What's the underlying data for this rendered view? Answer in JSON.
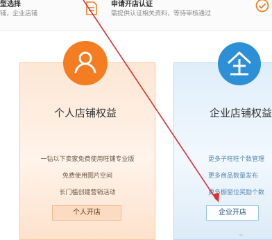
{
  "steps": {
    "step1": {
      "title": "型选择",
      "desc": "铺，企业店铺"
    },
    "step2": {
      "title": "申请开店认证",
      "desc": "需提供认证相关资料，等待审核通过"
    }
  },
  "personal": {
    "title": "个人店铺权益",
    "benefits": [
      "一钻以下卖家免费使用旺铺专业版",
      "免费使用图片空间",
      "长门槛创建营销活动"
    ],
    "button": "个人开店",
    "color": "#f47d22"
  },
  "enterprise": {
    "title": "企业店铺权益",
    "benefits": [
      "更多子旺旺个数管理",
      "更多商品数量发布",
      "更多橱窗位奖励个数"
    ],
    "button": "企业开店",
    "color": "#2d8fd5"
  },
  "annotation": {
    "color": "#e03030"
  },
  "icons": {
    "doc": "document-icon",
    "check": "check-circle-icon",
    "person": "person-icon",
    "enterprise": "enterprise-icon"
  }
}
